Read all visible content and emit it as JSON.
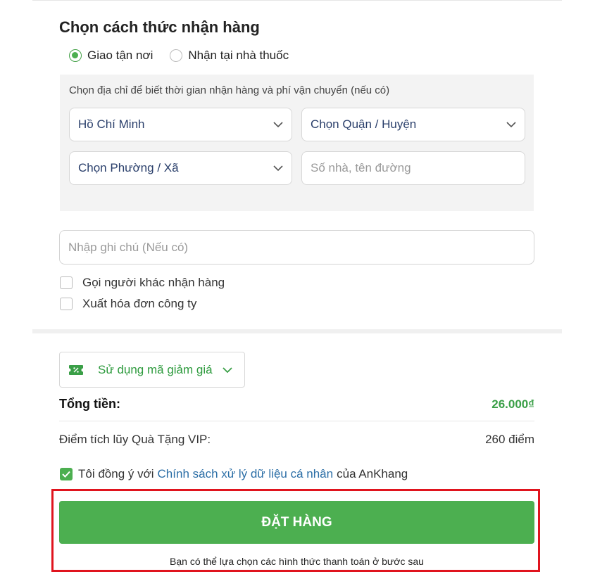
{
  "delivery": {
    "title": "Chọn cách thức nhận hàng",
    "options": [
      {
        "label": "Giao tận nơi",
        "checked": true
      },
      {
        "label": "Nhận tại nhà thuốc",
        "checked": false
      }
    ],
    "address_hint": "Chọn địa chỉ để biết thời gian nhận hàng và phí vận chuyển (nếu có)",
    "city": "Hồ Chí Minh",
    "district_placeholder": "Chọn Quận / Huyện",
    "ward_placeholder": "Chọn Phường / Xã",
    "street_placeholder": "Số nhà, tên đường"
  },
  "note_placeholder": "Nhập ghi chú (Nếu có)",
  "options": {
    "other_receiver": "Gọi người khác nhận hàng",
    "company_invoice": "Xuất hóa đơn công ty"
  },
  "promo": {
    "label": "Sử dụng mã giảm giá",
    "icon": "ticket-icon"
  },
  "summary": {
    "total_label": "Tổng tiền:",
    "total_value": "26.000₫",
    "points_label": "Điểm tích lũy Quà Tặng VIP:",
    "points_value": "260 điểm"
  },
  "agreement": {
    "prefix": "Tôi đồng ý với",
    "link": "Chính sách xử lý dữ liệu cá nhân",
    "suffix": "của AnKhang",
    "checked": true
  },
  "order_button": "ĐẶT HÀNG",
  "payment_note": "Bạn có thể lựa chọn các hình thức thanh toán ở bước sau",
  "colors": {
    "accent": "#4caf50",
    "link": "#2b6ea6",
    "highlight": "#e0141e",
    "total": "#3a9f47"
  }
}
